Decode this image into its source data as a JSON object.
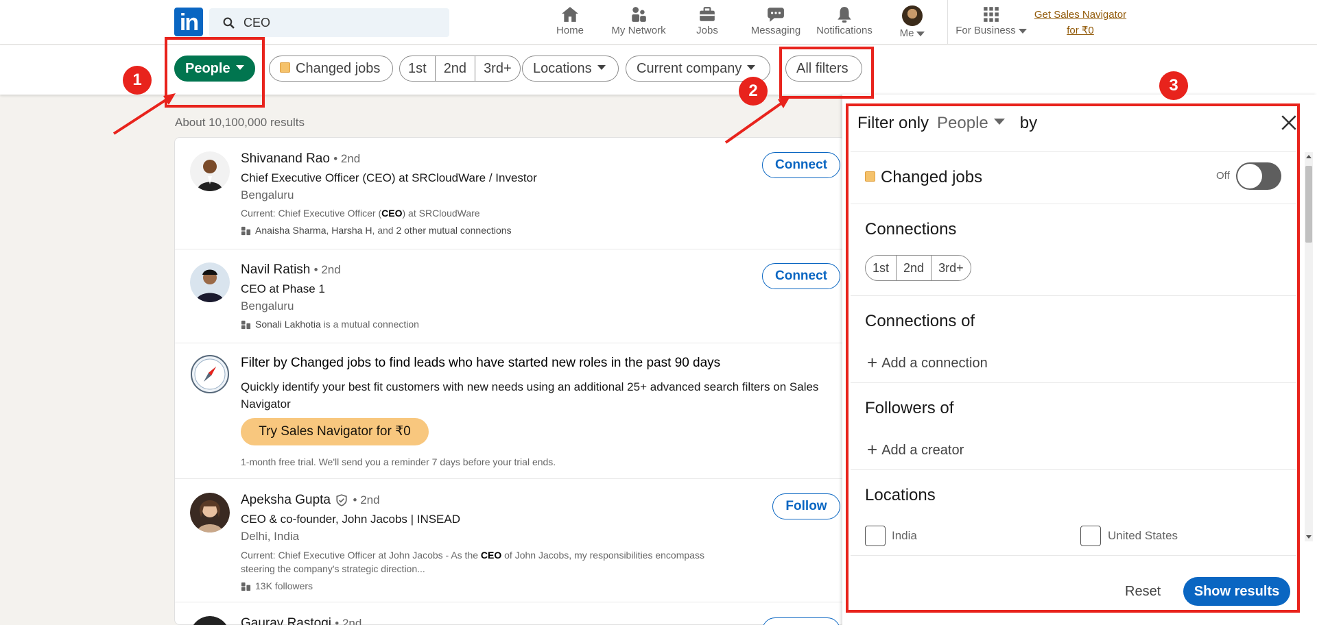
{
  "nav": {
    "logo": "in",
    "search_value": "CEO",
    "items": [
      {
        "label": "Home",
        "icon": "home-icon"
      },
      {
        "label": "My Network",
        "icon": "network-icon"
      },
      {
        "label": "Jobs",
        "icon": "jobs-icon"
      },
      {
        "label": "Messaging",
        "icon": "messaging-icon"
      },
      {
        "label": "Notifications",
        "icon": "bell-icon"
      },
      {
        "label": "Me",
        "icon": "avatar"
      }
    ],
    "for_business": "For Business",
    "sales_nav_line1": "Get Sales Navigator",
    "sales_nav_line2": "for ₹0"
  },
  "filters": {
    "people": "People",
    "changed_jobs": "Changed jobs",
    "degrees": [
      "1st",
      "2nd",
      "3rd+"
    ],
    "locations": "Locations",
    "current_company": "Current company",
    "all_filters": "All filters"
  },
  "results": {
    "count": "About 10,100,000 results",
    "rows": [
      {
        "name": "Shivanand Rao",
        "degree": "• 2nd",
        "headline": "Chief Executive Officer (CEO) at SRCloudWare / Investor",
        "location": "Bengaluru",
        "current_pre": "Current: Chief Executive Officer (",
        "current_bold": "CEO",
        "current_post": ") at SRCloudWare",
        "mutual_a": "Anaisha Sharma",
        "mutual_sep": ", ",
        "mutual_b": "Harsha H",
        "mutual_mid": ", and ",
        "mutual_c": "2 other mutual connections",
        "action": "Connect"
      },
      {
        "name": "Navil Ratish",
        "degree": "• 2nd",
        "headline": "CEO at Phase 1",
        "location": "Bengaluru",
        "mutual_a": "Sonali Lakhotia",
        "mutual_rest": " is a mutual connection",
        "action": "Connect"
      },
      {
        "promo_title": "Filter by Changed jobs to find leads who have started new roles in the past 90 days",
        "promo_body": "Quickly identify your best fit customers with new needs using an additional 25+ advanced search filters on Sales Navigator",
        "promo_button": "Try Sales Navigator for ₹0",
        "promo_note": "1-month free trial. We'll send you a reminder 7 days before your trial ends."
      },
      {
        "name": "Apeksha Gupta",
        "degree": "• 2nd",
        "headline": "CEO & co-founder, John Jacobs | INSEAD",
        "location": "Delhi, India",
        "current_pre": "Current: Chief Executive Officer at John Jacobs - As the ",
        "current_bold": "CEO",
        "current_post": " of John Jacobs, my responsibilities encompass",
        "current_line2": "steering the company's strategic direction...",
        "followers": "13K followers",
        "action": "Follow"
      },
      {
        "name": "Gaurav Rastogi",
        "degree": "• 2nd"
      }
    ]
  },
  "panel": {
    "title_prefix": "Filter only",
    "title_select": "People",
    "title_suffix": "by",
    "changed_jobs": "Changed jobs",
    "toggle_label": "Off",
    "connections_title": "Connections",
    "degrees": [
      "1st",
      "2nd",
      "3rd+"
    ],
    "connections_of_title": "Connections of",
    "add_connection": "Add a connection",
    "followers_of_title": "Followers of",
    "add_creator": "Add a creator",
    "locations_title": "Locations",
    "loc_a": "India",
    "loc_b": "United States",
    "reset": "Reset",
    "show_results": "Show results"
  },
  "annotations": [
    "1",
    "2",
    "3"
  ],
  "colors": {
    "linkedin_blue": "#0a66c2",
    "people_green": "#01754f",
    "annotation_red": "#e8231c",
    "promo_orange": "#f8c77e"
  }
}
